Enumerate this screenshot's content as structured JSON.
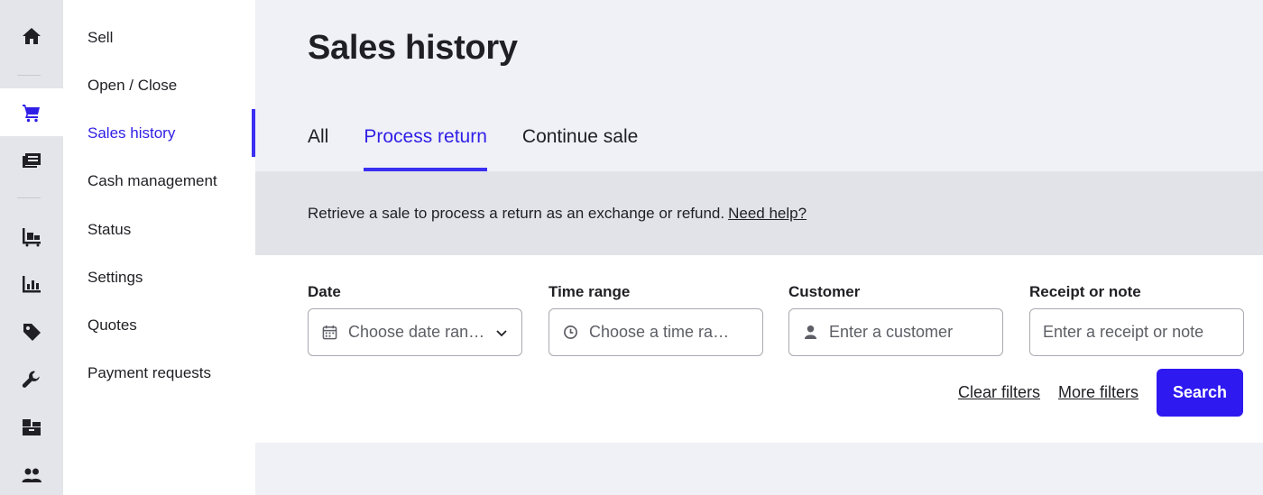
{
  "rail": {
    "items": [
      {
        "icon": "home-icon",
        "active": false
      },
      {
        "icon": "cart-icon",
        "active": true
      },
      {
        "icon": "register-icon",
        "active": false
      },
      {
        "icon": "inventory-cart-icon",
        "active": false
      },
      {
        "icon": "bar-chart-icon",
        "active": false
      },
      {
        "icon": "tag-icon",
        "active": false
      },
      {
        "icon": "wrench-icon",
        "active": false
      },
      {
        "icon": "boxes-icon",
        "active": false
      },
      {
        "icon": "users-icon",
        "active": false
      }
    ],
    "colors": {
      "icon": "#1f1f24",
      "active_icon": "#2f1fe6"
    }
  },
  "subnav": {
    "items": [
      {
        "label": "Sell"
      },
      {
        "label": "Open / Close"
      },
      {
        "label": "Sales history"
      },
      {
        "label": "Cash management"
      },
      {
        "label": "Status"
      },
      {
        "label": "Settings"
      },
      {
        "label": "Quotes"
      },
      {
        "label": "Payment requests"
      }
    ],
    "active_label": "Sales history"
  },
  "main": {
    "title": "Sales history",
    "tabs": [
      {
        "label": "All"
      },
      {
        "label": "Process return"
      },
      {
        "label": "Continue sale"
      }
    ],
    "active_tab": "Process return",
    "banner": {
      "text": "Retrieve a sale to process a return as an exchange or refund.",
      "link": "Need help?"
    },
    "filters": {
      "date": {
        "label": "Date",
        "placeholder": "Choose date ran…",
        "icon": "calendar-icon"
      },
      "time_range": {
        "label": "Time range",
        "placeholder": "Choose a time ra…",
        "icon": "clock-icon"
      },
      "customer": {
        "label": "Customer",
        "placeholder": "Enter a customer",
        "icon": "person-icon"
      },
      "receipt": {
        "label": "Receipt or note",
        "placeholder": "Enter a receipt or note"
      }
    },
    "actions": {
      "clear_filters": "Clear filters",
      "more_filters": "More filters",
      "search": "Search"
    }
  },
  "colors": {
    "accent": "#2e19f0",
    "page_bg": "#f0f1f6",
    "banner_bg": "#e2e3e8"
  }
}
